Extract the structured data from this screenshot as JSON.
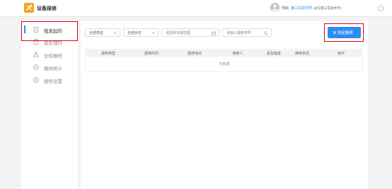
{
  "app": {
    "title": "设备报修"
  },
  "user": {
    "greeting": "你好,",
    "name": "第三实验中学",
    "school": "(武汉第三实验中学)"
  },
  "sidebar": {
    "items": [
      {
        "label": "我发起的",
        "icon": "document-icon"
      },
      {
        "label": "我处理的",
        "icon": "clipboard-icon"
      },
      {
        "label": "全校报修",
        "icon": "warning-icon"
      },
      {
        "label": "报修统计",
        "icon": "stats-icon"
      },
      {
        "label": "报修设置",
        "icon": "settings-icon"
      }
    ]
  },
  "filters": {
    "type": {
      "value": "全部类型"
    },
    "status": {
      "value": "全部状态"
    },
    "date": {
      "placeholder": "请选择日期范围"
    },
    "search": {
      "placeholder": "请输入报修单号"
    }
  },
  "toolbar": {
    "launch_label": "发起报修"
  },
  "table": {
    "columns": [
      "报修类型",
      "报修时间",
      "报修地点",
      "维修人",
      "紧急程度",
      "维修状态",
      "操作"
    ],
    "empty_text": "无数据"
  },
  "colors": {
    "accent": "#2d8cf0",
    "logo": "#f7a21b",
    "highlight_box": "#e60012"
  }
}
